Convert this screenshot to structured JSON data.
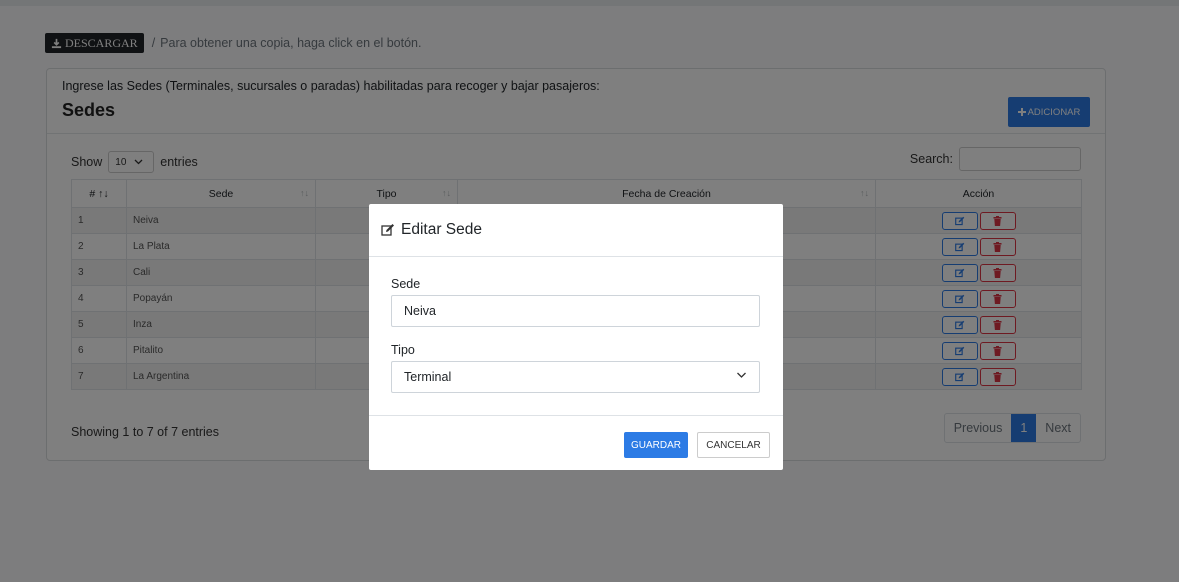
{
  "download": {
    "label": "DESCARGAR",
    "note": "Para obtener una copia, haga click en el botón.",
    "separator": "/"
  },
  "card": {
    "subtitle": "Ingrese las Sedes (Terminales, sucursales o paradas) habilitadas para recoger y bajar pasajeros:",
    "title": "Sedes",
    "add_label": "ADICIONAR"
  },
  "table_controls": {
    "show": "Show",
    "length": "10",
    "entries": "entries",
    "search": "Search:"
  },
  "table": {
    "columns": [
      "# ↑↓",
      "Sede",
      "Tipo",
      "Fecha de Creación",
      "Acción"
    ],
    "sort_glyph": "↑↓",
    "rows": [
      {
        "num": "1",
        "sede": "Neiva",
        "tipo_color": "#2c7be5"
      },
      {
        "num": "2",
        "sede": "La Plata",
        "tipo_color": "#28a745"
      },
      {
        "num": "3",
        "sede": "Cali",
        "tipo_color": "#2c7be5"
      },
      {
        "num": "4",
        "sede": "Popayán",
        "tipo_color": "#2c7be5"
      },
      {
        "num": "5",
        "sede": "Inza",
        "tipo_color": "#6c757d"
      },
      {
        "num": "6",
        "sede": "Pitalito",
        "tipo_color": "#6c757d"
      },
      {
        "num": "7",
        "sede": "La Argentina",
        "tipo_color": "#6c757d"
      }
    ],
    "info": "Showing 1 to 7 of 7 entries",
    "pager": {
      "prev": "Previous",
      "page": "1",
      "next": "Next"
    }
  },
  "modal": {
    "title": "Editar Sede",
    "sede_label": "Sede",
    "sede_value": "Neiva",
    "tipo_label": "Tipo",
    "tipo_value": "Terminal",
    "save_label": "GUARDAR",
    "cancel_label": "CANCELAR"
  },
  "colors": {
    "primary": "#2c7be5",
    "danger": "#dc3545",
    "dark": "#212529"
  }
}
